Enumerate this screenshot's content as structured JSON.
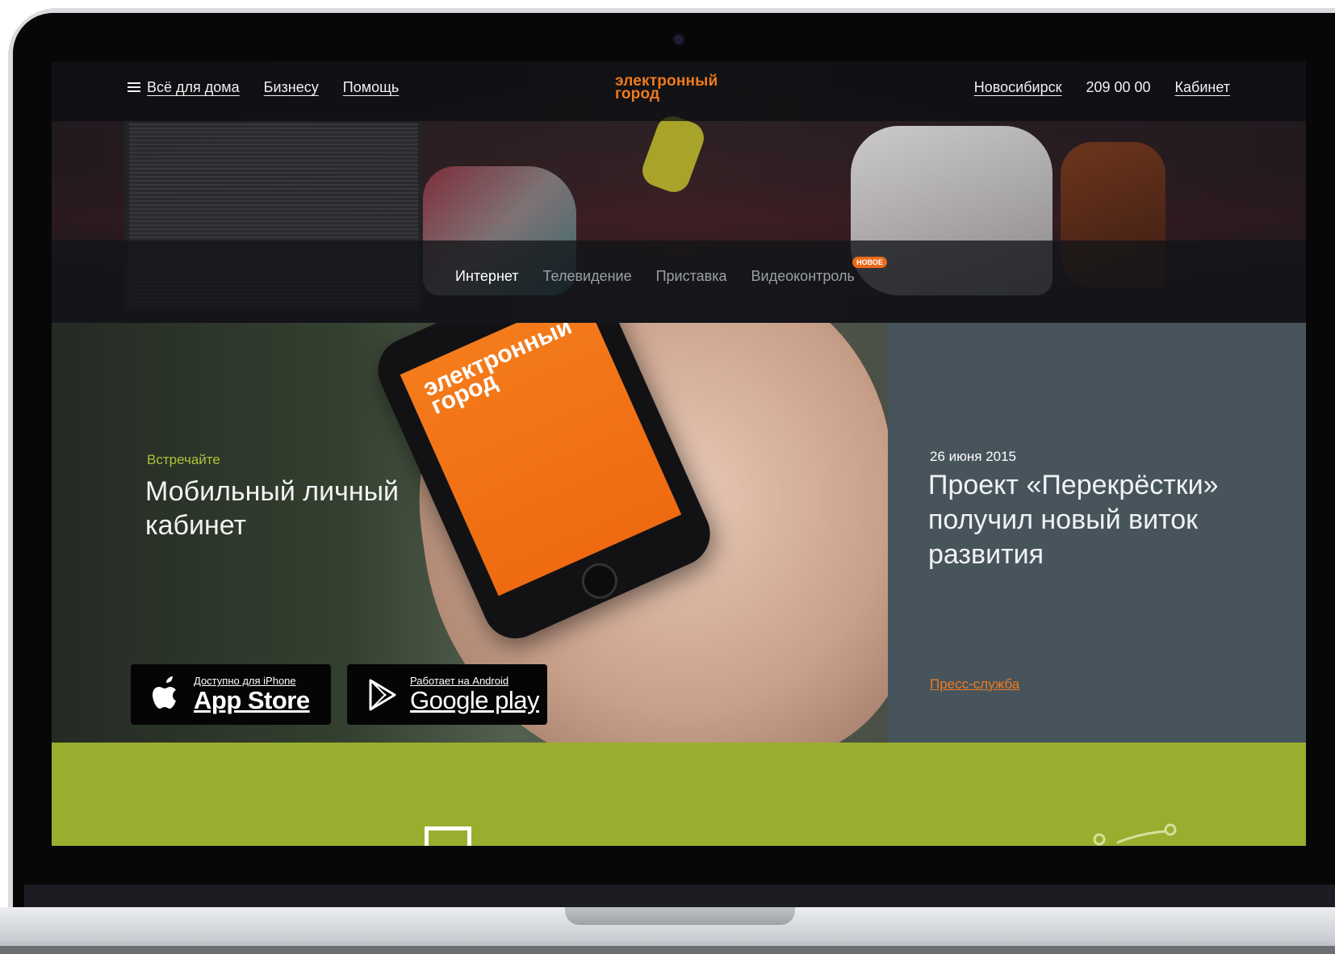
{
  "header": {
    "nav": [
      {
        "label": "Всё для дома"
      },
      {
        "label": "Бизнесу"
      },
      {
        "label": "Помощь"
      }
    ],
    "logo": {
      "line1": "электронный",
      "line2": "город"
    },
    "city": "Новосибирск",
    "phone": "209 00 00",
    "cabinet": "Кабинет"
  },
  "subnav": {
    "tabs": [
      {
        "label": "Интернет",
        "active": true
      },
      {
        "label": "Телевидение",
        "active": false
      },
      {
        "label": "Приставка",
        "active": false
      },
      {
        "label": "Видеоконтроль",
        "active": false,
        "badge": "НОВОЕ"
      }
    ]
  },
  "promo": {
    "kicker": "Встречайте",
    "title": "Мобильный личный кабинет",
    "phone_logo": {
      "line1": "электронный",
      "line2": "город"
    },
    "appstore": {
      "small": "Доступно для iPhone",
      "big": "App Store"
    },
    "gplay": {
      "small": "Работает на Android",
      "big": "Google play"
    }
  },
  "news": {
    "date": "26 июня 2015",
    "title": "Проект «Перекрёстки» получил новый виток развития",
    "link": "Пресс-служба"
  },
  "colors": {
    "accent_orange": "#f07a1e",
    "kicker_green": "#a8c23a",
    "band_green": "#9bad2e",
    "news_bg": "#48545c"
  }
}
